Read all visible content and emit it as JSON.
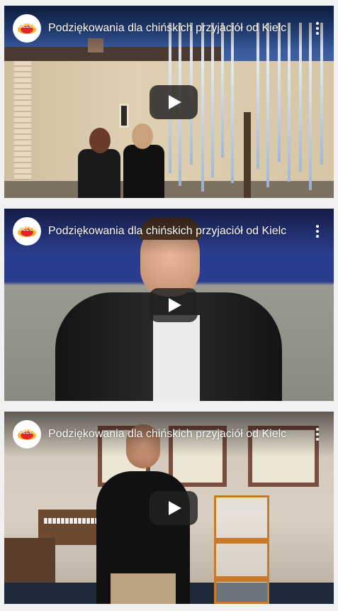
{
  "videos": [
    {
      "title": "Podziękowania dla chińskich przyjaciół od Kielc",
      "channel_logo_text": "KIELCE",
      "menu_icon": "more-vert-icon",
      "play_icon": "play-icon"
    },
    {
      "title": "Podziękowania dla chińskich przyjaciół od Kielc",
      "channel_logo_text": "KIELCE",
      "menu_icon": "more-vert-icon",
      "play_icon": "play-icon"
    },
    {
      "title": "Podziękowania dla chińskich przyjaciół od Kielc",
      "channel_logo_text": "KIELCE",
      "menu_icon": "more-vert-icon",
      "play_icon": "play-icon"
    }
  ],
  "colors": {
    "page_background": "#f1f1f1",
    "play_button": "#212121",
    "title_text": "#ffffff",
    "logo_red": "#e42528",
    "logo_yellow": "#f7b733"
  }
}
